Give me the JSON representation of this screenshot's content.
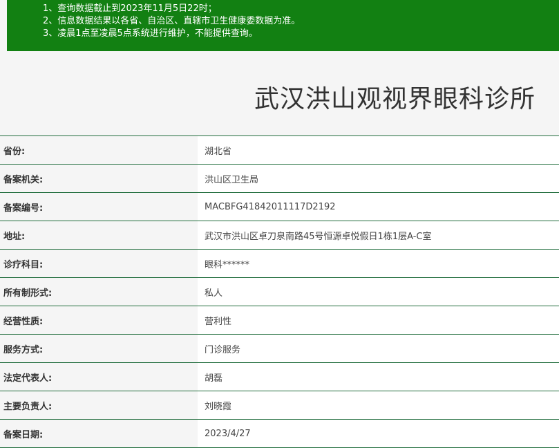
{
  "notice": {
    "lines": [
      "1、查询数据截止到2023年11月5日22时；",
      "2、信息数据结果以各省、自治区、直辖市卫生健康委数据为准。",
      "3、凌晨1点至凌晨5点系统进行维护，不能提供查询。"
    ]
  },
  "title": "武汉洪山观视界眼科诊所",
  "rows": [
    {
      "label": "省份:",
      "value": "湖北省"
    },
    {
      "label": "备案机关:",
      "value": "洪山区卫生局"
    },
    {
      "label": "备案编号:",
      "value": "MACBFG41842011117D2192"
    },
    {
      "label": "地址:",
      "value": "武汉市洪山区卓刀泉南路45号恒源卓悦假日1栋1层A-C室"
    },
    {
      "label": "诊疗科目:",
      "value": "眼科******"
    },
    {
      "label": "所有制形式:",
      "value": "私人"
    },
    {
      "label": "经营性质:",
      "value": "营利性"
    },
    {
      "label": "服务方式:",
      "value": "门诊服务"
    },
    {
      "label": "法定代表人:",
      "value": "胡磊"
    },
    {
      "label": "主要负责人:",
      "value": "刘晓霞"
    },
    {
      "label": "备案日期:",
      "value": "2023/4/27"
    }
  ],
  "colors": {
    "notice_bg": "#128012",
    "row_border": "#1e6b3a"
  }
}
